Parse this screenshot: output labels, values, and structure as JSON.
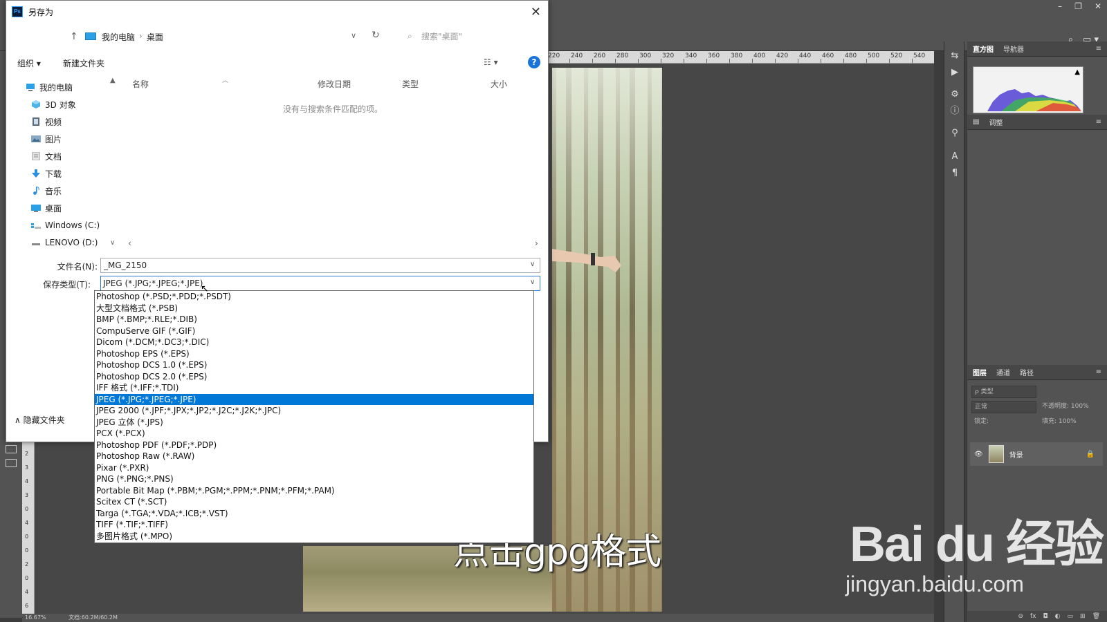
{
  "photoshop": {
    "window_controls": [
      "–",
      "❐",
      "✕"
    ],
    "ruler_labels": [
      "220",
      "240",
      "260",
      "280",
      "300",
      "320",
      "340",
      "360",
      "380",
      "400",
      "420",
      "440",
      "460",
      "480",
      "500",
      "520",
      "540"
    ],
    "vruler_labels": [
      "0",
      "2",
      "3",
      "4",
      "3",
      "0",
      "4",
      "0",
      "0",
      "2",
      "0",
      "4",
      "6"
    ],
    "status_zoom": "16.67%",
    "status_doc": "文档:60.2M/60.2M",
    "panel_top_tabs": [
      "直方图",
      "导航器"
    ],
    "panel_mid_tabs": [
      "调整"
    ],
    "panel_layers_tabs": [
      "图层",
      "通道",
      "路径"
    ],
    "layers_filter": "ρ 类型",
    "blend_mode": "正常",
    "opacity_label": "不透明度: 100%",
    "lock_label": "锁定:",
    "fill_label": "填充: 100%",
    "layer_name": "背景"
  },
  "dialog": {
    "title": "另存为",
    "app_icon": "Ps",
    "breadcrumb": [
      "我的电脑",
      "桌面"
    ],
    "search_placeholder": "搜索\"桌面\"",
    "organize": "组织 ▾",
    "new_folder": "新建文件夹",
    "view_toggle": "☷ ▾",
    "help": "?",
    "nav": [
      {
        "label": "我的电脑",
        "icon": "computer-icon"
      },
      {
        "label": "3D 对象",
        "icon": "cube-icon"
      },
      {
        "label": "视频",
        "icon": "video-icon"
      },
      {
        "label": "图片",
        "icon": "picture-icon"
      },
      {
        "label": "文档",
        "icon": "document-icon"
      },
      {
        "label": "下载",
        "icon": "download-icon"
      },
      {
        "label": "音乐",
        "icon": "music-icon"
      },
      {
        "label": "桌面",
        "icon": "desktop-icon"
      },
      {
        "label": "Windows (C:)",
        "icon": "drive-icon"
      },
      {
        "label": "LENOVO (D:)",
        "icon": "drive-icon"
      }
    ],
    "columns": [
      "名称",
      "修改日期",
      "类型",
      "大小"
    ],
    "empty_message": "没有与搜索条件匹配的项。",
    "filename_label": "文件名(N):",
    "filename_value": "_MG_2150",
    "filetype_label": "保存类型(T):",
    "filetype_value": "JPEG (*.JPG;*.JPEG;*.JPE)",
    "hide_folders": "隐藏文件夹",
    "filetype_options": [
      "Photoshop (*.PSD;*.PDD;*.PSDT)",
      "大型文档格式 (*.PSB)",
      "BMP (*.BMP;*.RLE;*.DIB)",
      "CompuServe GIF (*.GIF)",
      "Dicom (*.DCM;*.DC3;*.DIC)",
      "Photoshop EPS (*.EPS)",
      "Photoshop DCS 1.0 (*.EPS)",
      "Photoshop DCS 2.0 (*.EPS)",
      "IFF 格式 (*.IFF;*.TDI)",
      "JPEG (*.JPG;*.JPEG;*.JPE)",
      "JPEG 2000 (*.JPF;*.JPX;*.JP2;*.J2C;*.J2K;*.JPC)",
      "JPEG 立体 (*.JPS)",
      "PCX (*.PCX)",
      "Photoshop PDF (*.PDF;*.PDP)",
      "Photoshop Raw (*.RAW)",
      "Pixar (*.PXR)",
      "PNG (*.PNG;*.PNS)",
      "Portable Bit Map (*.PBM;*.PGM;*.PPM;*.PNM;*.PFM;*.PAM)",
      "Scitex CT (*.SCT)",
      "Targa (*.TGA;*.VDA;*.ICB;*.VST)",
      "TIFF (*.TIF;*.TIFF)",
      "多图片格式 (*.MPO)"
    ],
    "selected_option": "JPEG (*.JPG;*.JPEG;*.JPE)"
  },
  "caption": "点击gpg格式",
  "watermark": {
    "logo": "Bai du 经验",
    "url": "jingyan.baidu.com"
  },
  "colors": {
    "accent": "#0078d7",
    "ps_panel": "#535353",
    "ps_canvas": "#474747"
  }
}
